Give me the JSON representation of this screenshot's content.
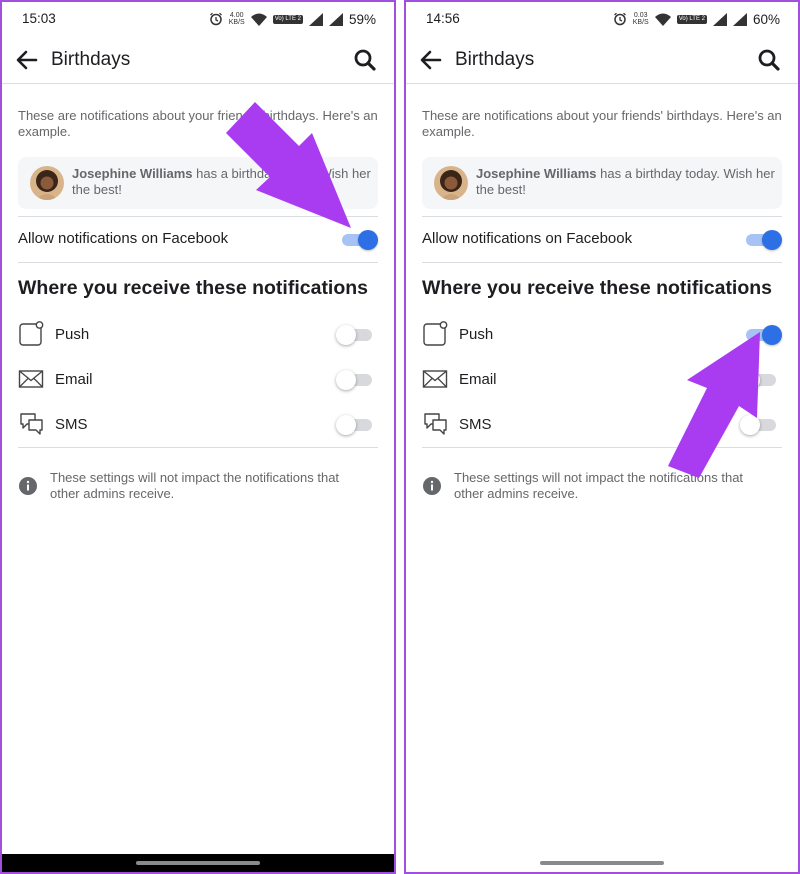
{
  "colors": {
    "frame_border": "#a24fe0",
    "toggle_on": "#2d6fe4",
    "toggle_on_track": "#a7c3f5",
    "annotation_arrow": "#a93cf0"
  },
  "screens": [
    {
      "status": {
        "time": "15:03",
        "net_speed": "4.00 KB/S",
        "volte": "Vo) LTE 2",
        "battery": "59%"
      },
      "header": {
        "title": "Birthdays",
        "back_icon": "arrow-left-icon",
        "search_icon": "search-icon"
      },
      "intro": "These are notifications about your friends' birthdays. Here's an example.",
      "example": {
        "name": "Josephine Williams",
        "message": " has a birthday today. Wish her the best!"
      },
      "allow": {
        "label": "Allow notifications on Facebook",
        "on": true
      },
      "section_title": "Where you receive these notifications",
      "channels": [
        {
          "label": "Push",
          "icon": "push-notification-icon",
          "on": false
        },
        {
          "label": "Email",
          "icon": "email-icon",
          "on": false
        },
        {
          "label": "SMS",
          "icon": "sms-icon",
          "on": false
        }
      ],
      "note": "These settings will not impact the notifications that other admins receive."
    },
    {
      "status": {
        "time": "14:56",
        "net_speed": "0.03 KB/S",
        "volte": "Vo) LTE 2",
        "battery": "60%"
      },
      "header": {
        "title": "Birthdays",
        "back_icon": "arrow-left-icon",
        "search_icon": "search-icon"
      },
      "intro": "These are notifications about your friends' birthdays. Here's an example.",
      "example": {
        "name": "Josephine Williams",
        "message": " has a birthday today. Wish her the best!"
      },
      "allow": {
        "label": "Allow notifications on Facebook",
        "on": true
      },
      "section_title": "Where you receive these notifications",
      "channels": [
        {
          "label": "Push",
          "icon": "push-notification-icon",
          "on": true
        },
        {
          "label": "Email",
          "icon": "email-icon",
          "on": false
        },
        {
          "label": "SMS",
          "icon": "sms-icon",
          "on": false
        }
      ],
      "note": "These settings will not impact the notifications that other admins receive."
    }
  ]
}
